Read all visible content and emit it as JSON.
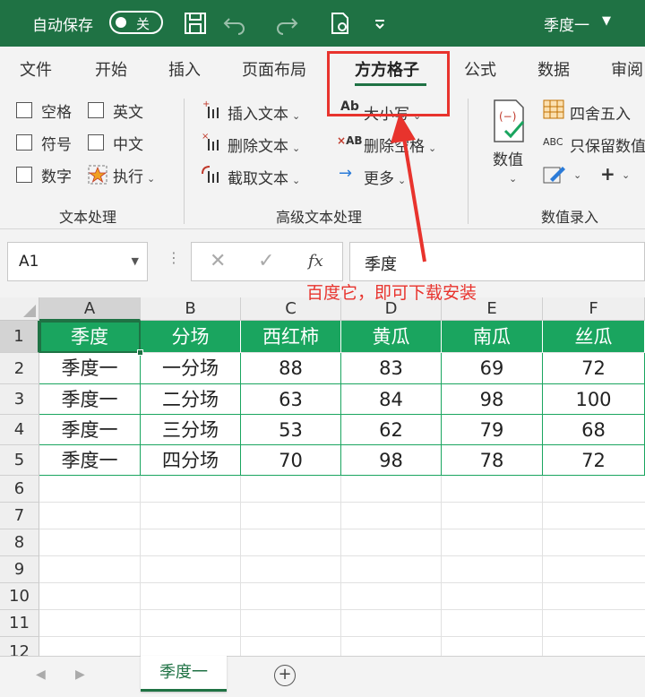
{
  "titlebar": {
    "autosave_label": "自动保存",
    "toggle_state": "关",
    "doc_title": "季度一"
  },
  "ribbon_tabs": [
    "文件",
    "开始",
    "插入",
    "页面布局",
    "方方格子",
    "公式",
    "数据",
    "审阅"
  ],
  "active_tab": "方方格子",
  "ribbon": {
    "text_group": {
      "items": [
        "空格",
        "英文",
        "符号",
        "中文",
        "数字",
        "执行"
      ],
      "label": "文本处理"
    },
    "adv_group": {
      "insert": "插入文本",
      "delete": "删除文本",
      "extract": "截取文本",
      "case": "大小写",
      "delete_space": "删除空格",
      "more": "更多",
      "label": "高级文本处理"
    },
    "num_group": {
      "big_button": "数值",
      "round": "四舍五入",
      "keep_value": "只保留数值",
      "label": "数值录入"
    }
  },
  "formula_bar": {
    "name_box": "A1",
    "fx": "fx",
    "value": "季度"
  },
  "annotation": "百度它，即可下载安装",
  "columns": [
    "A",
    "B",
    "C",
    "D",
    "E",
    "F"
  ],
  "rows": [
    "1",
    "2",
    "3",
    "4",
    "5",
    "6",
    "7",
    "8",
    "9",
    "10",
    "11",
    "12"
  ],
  "table": {
    "header": [
      "季度",
      "分场",
      "西红柿",
      "黄瓜",
      "南瓜",
      "丝瓜"
    ],
    "rows": [
      [
        "季度一",
        "一分场",
        "88",
        "83",
        "69",
        "72"
      ],
      [
        "季度一",
        "二分场",
        "63",
        "84",
        "98",
        "100"
      ],
      [
        "季度一",
        "三分场",
        "53",
        "62",
        "79",
        "68"
      ],
      [
        "季度一",
        "四分场",
        "70",
        "98",
        "78",
        "72"
      ]
    ]
  },
  "sheet_tab": "季度一",
  "colors": {
    "excel_green": "#1f7244",
    "table_green": "#1aa55f",
    "annotation_red": "#e8332d"
  }
}
